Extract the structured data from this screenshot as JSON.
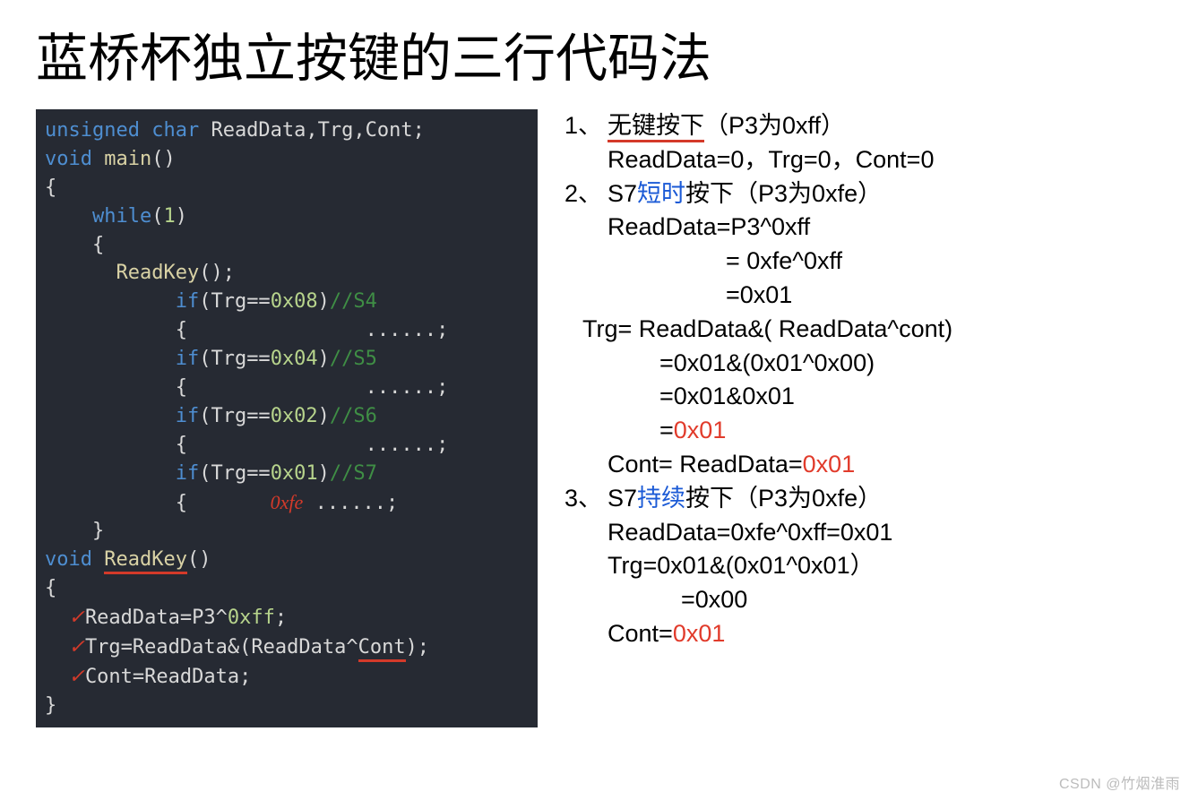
{
  "title": "蓝桥杯独立按键的三行代码法",
  "code": {
    "decl_kw1": "unsigned",
    "decl_kw2": "char",
    "decl_vars": " ReadData,Trg,Cont;",
    "void": "void",
    "main": "main",
    "while": "while",
    "one": "1",
    "readkey_call": "ReadKey",
    "trg_eq08": "Trg==",
    "x08": "0x08",
    "c_s4": "//S4",
    "x04": "0x04",
    "c_s5": "//S5",
    "x02": "0x02",
    "c_s6": "//S6",
    "x01": "0x01",
    "c_s7": "//S7",
    "dots": "......;",
    "ann_oxfe": "0xfe",
    "readkey_fn": "ReadKey",
    "body1": "ReadData=P3^",
    "body1_hex": "0xff",
    "body2": "Trg=ReadData&(ReadData^Cont);",
    "body3": "Cont=ReadData;"
  },
  "notes": {
    "n1_idx": "1、",
    "n1_title_a": "无键按下",
    "n1_title_b": "（P3为0xff）",
    "n1_line": "ReadData=0，Trg=0，Cont=0",
    "n2_idx": "2、",
    "n2_a": "S7",
    "n2_b": "短时",
    "n2_c": "按下（P3为0xfe）",
    "n2_rd": "ReadData=P3^0xff",
    "n2_rd2": "= 0xfe^0xff",
    "n2_rd3": "=0x01",
    "n2_trg": "Trg= ReadData&( ReadData^cont)",
    "n2_trg2": "=0x01&(0x01^0x00)",
    "n2_trg3": "=0x01&0x01",
    "n2_trg4a": "=",
    "n2_trg4b": "0x01",
    "n2_cont_a": "Cont= ReadData=",
    "n2_cont_b": "0x01",
    "n3_idx": "3、",
    "n3_a": "S7",
    "n3_b": "持续",
    "n3_c": "按下（P3为0xfe）",
    "n3_rd": "ReadData=0xfe^0xff=0x01",
    "n3_trg": "Trg=0x01&(0x01^0x01）",
    "n3_trg2": "=0x00",
    "n3_cont_a": "Cont=",
    "n3_cont_b": "0x01"
  },
  "watermark": "CSDN @竹烟淮雨"
}
